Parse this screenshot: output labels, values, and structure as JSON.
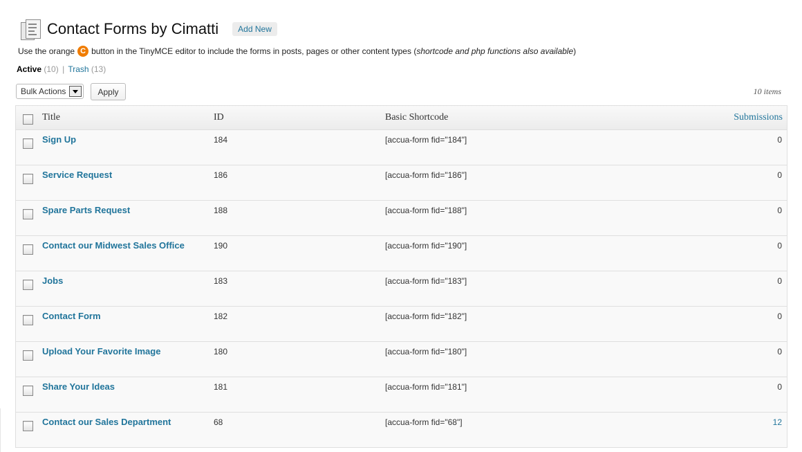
{
  "header": {
    "title": "Contact Forms by Cimatti",
    "add_new_label": "Add New",
    "icon": "forms-icon"
  },
  "info": {
    "prefix": "Use the orange",
    "badge": "C",
    "middle": "button in the TinyMCE editor to include the forms in posts, pages or other content types (",
    "italic": "shortcode and php functions also available",
    "suffix": ")"
  },
  "filters": {
    "active_label": "Active",
    "active_count": "(10)",
    "separator": "|",
    "trash_label": "Trash",
    "trash_count": "(13)"
  },
  "toolbar": {
    "bulk_actions_label": "Bulk Actions",
    "apply_label": "Apply",
    "items_count": "10 items"
  },
  "table": {
    "columns": {
      "title": "Title",
      "id": "ID",
      "shortcode": "Basic Shortcode",
      "submissions": "Submissions"
    },
    "rows": [
      {
        "title": "Sign Up",
        "id": "184",
        "shortcode": "[accua-form fid=\"184\"]",
        "submissions": "0"
      },
      {
        "title": "Service Request",
        "id": "186",
        "shortcode": "[accua-form fid=\"186\"]",
        "submissions": "0"
      },
      {
        "title": "Spare Parts Request",
        "id": "188",
        "shortcode": "[accua-form fid=\"188\"]",
        "submissions": "0"
      },
      {
        "title": "Contact our Midwest Sales Office",
        "id": "190",
        "shortcode": "[accua-form fid=\"190\"]",
        "submissions": "0"
      },
      {
        "title": "Jobs",
        "id": "183",
        "shortcode": "[accua-form fid=\"183\"]",
        "submissions": "0"
      },
      {
        "title": "Contact Form",
        "id": "182",
        "shortcode": "[accua-form fid=\"182\"]",
        "submissions": "0"
      },
      {
        "title": "Upload Your Favorite Image",
        "id": "180",
        "shortcode": "[accua-form fid=\"180\"]",
        "submissions": "0"
      },
      {
        "title": "Share Your Ideas",
        "id": "181",
        "shortcode": "[accua-form fid=\"181\"]",
        "submissions": "0"
      },
      {
        "title": "Contact our Sales Department",
        "id": "68",
        "shortcode": "[accua-form fid=\"68\"]",
        "submissions": "12"
      }
    ]
  },
  "colors": {
    "link": "#21759b",
    "badge": "#f07c00"
  }
}
